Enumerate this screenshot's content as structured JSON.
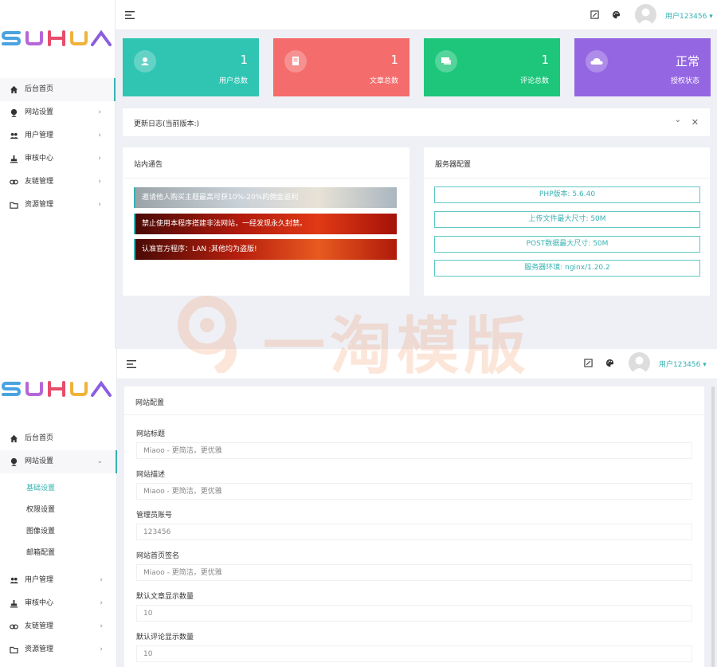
{
  "colors": {
    "accent": "#37b3b2",
    "card_users": "#30c5b3",
    "card_articles": "#f56c6c",
    "card_comments": "#1dc67a",
    "card_license": "#9466e2"
  },
  "logo": {
    "text": "SUHUA"
  },
  "top": {
    "user": "用户123456",
    "sidebar": [
      {
        "label": "后台首页",
        "icon": "home-icon"
      },
      {
        "label": "网站设置",
        "icon": "globe-icon"
      },
      {
        "label": "用户管理",
        "icon": "users-icon"
      },
      {
        "label": "审核中心",
        "icon": "stamp-icon"
      },
      {
        "label": "友链管理",
        "icon": "link-icon"
      },
      {
        "label": "资源管理",
        "icon": "folder-icon"
      }
    ],
    "cards": [
      {
        "value": "1",
        "label": "用户总数",
        "icon": "user-icon"
      },
      {
        "value": "1",
        "label": "文章总数",
        "icon": "document-icon"
      },
      {
        "value": "1",
        "label": "评论总数",
        "icon": "comment-icon"
      },
      {
        "value": "正常",
        "label": "授权状态",
        "icon": "cloud-icon"
      }
    ],
    "changelog_title": "更新日志(当前版本:)",
    "notice_title": "站内通告",
    "notices": [
      "邀请他人购买主题最高可获10%-20%的佣金返利",
      "禁止使用本程序搭建非法网站，一经发现永久封禁。",
      "认准官方程序：LAN ;其他均为盗版!"
    ],
    "server_title": "服务器配置",
    "server": [
      "PHP版本: 5.6.40",
      "上传文件最大尺寸: 50M",
      "POST数据最大尺寸: 50M",
      "服务器环境: nginx/1.20.2"
    ]
  },
  "watermark": "一淘模版",
  "bottom": {
    "user": "用户123456",
    "sidebar_top": [
      {
        "label": "后台首页",
        "icon": "home-icon"
      },
      {
        "label": "网站设置",
        "icon": "globe-icon"
      }
    ],
    "submenu": [
      "基础设置",
      "权限设置",
      "图像设置",
      "邮箱配置"
    ],
    "sidebar_bottom": [
      {
        "label": "用户管理",
        "icon": "users-icon"
      },
      {
        "label": "审核中心",
        "icon": "stamp-icon"
      },
      {
        "label": "友链管理",
        "icon": "link-icon"
      },
      {
        "label": "资源管理",
        "icon": "folder-icon"
      }
    ],
    "form_title": "网站配置",
    "fields": [
      {
        "label": "网站标题",
        "value": "Miaoo - 更简洁，更优雅"
      },
      {
        "label": "网站描述",
        "value": "Miaoo - 更简洁，更优雅"
      },
      {
        "label": "管理员账号",
        "value": "123456"
      },
      {
        "label": "网站首页签名",
        "value": "Miaoo - 更简洁，更优雅"
      },
      {
        "label": "默认文章显示数量",
        "value": "10"
      },
      {
        "label": "默认评论显示数量",
        "value": "10"
      }
    ]
  }
}
